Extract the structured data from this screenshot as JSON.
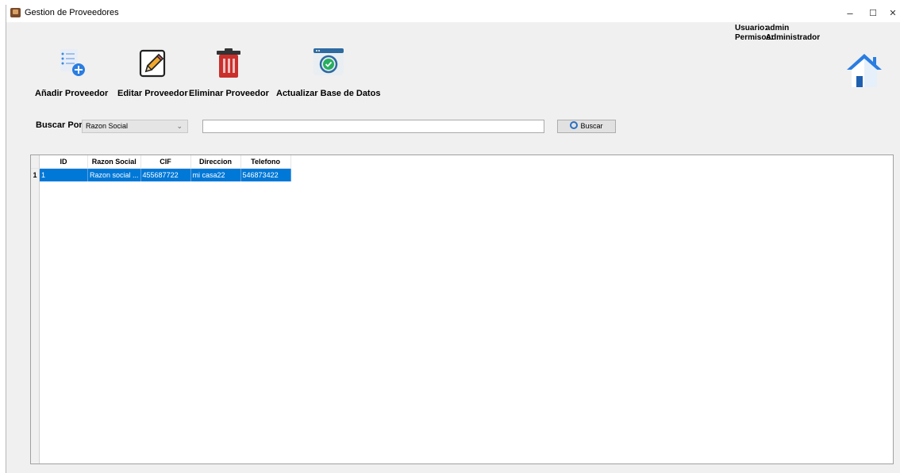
{
  "window": {
    "title": "Gestion de Proveedores",
    "controls": {
      "minimize": "–",
      "maximize": "☐",
      "close": "✕"
    }
  },
  "user": {
    "usuario_label": "Usuario:",
    "usuario_value": "admin",
    "permisos_label": "Permisos:",
    "permisos_value": "Administrador"
  },
  "toolbar": {
    "add": {
      "label": "Añadir Proveedor",
      "icon": "add-list-icon"
    },
    "edit": {
      "label": "Editar Proveedor",
      "icon": "edit-pencil-icon"
    },
    "delete": {
      "label": "Eliminar Proveedor",
      "icon": "trash-icon"
    },
    "refresh": {
      "label": "Actualizar Base de Datos",
      "icon": "refresh-database-icon"
    },
    "home": {
      "icon": "home-icon"
    }
  },
  "search": {
    "label": "Buscar Por:",
    "selected": "Razon Social",
    "input_value": "",
    "button_label": "Buscar"
  },
  "table": {
    "columns": [
      "ID",
      "Razon Social",
      "CIF",
      "Direccion",
      "Telefono"
    ],
    "rows": [
      {
        "rownum": "1",
        "cells": [
          "1",
          "Razon social ...",
          "455687722",
          "mi casa22",
          "546873422"
        ]
      }
    ]
  },
  "colors": {
    "selection": "#0078d7",
    "home_blue": "#2a7de1",
    "trash_red": "#c9302c"
  }
}
